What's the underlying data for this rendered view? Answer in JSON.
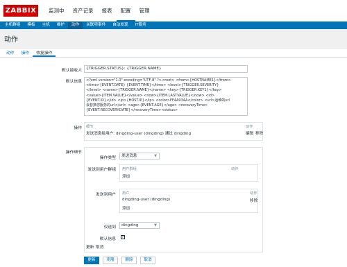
{
  "app": {
    "logo": "ZABBIX"
  },
  "main_menu": [
    {
      "label": "监测中",
      "active": false
    },
    {
      "label": "资产记录",
      "active": false
    },
    {
      "label": "报表",
      "active": false
    },
    {
      "label": "配置",
      "active": true
    },
    {
      "label": "管理",
      "active": false
    }
  ],
  "sub_menu": [
    {
      "label": "主机群组",
      "active": false
    },
    {
      "label": "模板",
      "active": false
    },
    {
      "label": "主机",
      "active": false
    },
    {
      "label": "维护",
      "active": false
    },
    {
      "label": "动作",
      "active": true
    },
    {
      "label": "关联项事件",
      "active": false
    },
    {
      "label": "自动发现",
      "active": false
    },
    {
      "label": "IT服务",
      "active": false
    }
  ],
  "page": {
    "title": "动作"
  },
  "tabs": [
    {
      "label": "动作",
      "active": false
    },
    {
      "label": "操作",
      "active": false
    },
    {
      "label": "恢复操作",
      "active": true
    }
  ],
  "form": {
    "default_subject_label": "默认接收人",
    "default_subject_value": "{TRIGGER.STATUS}: {TRIGGER.NAME}",
    "default_message_label": "默认信息",
    "default_message_lines": [
      "<?xml version=\"1.0\" encoding=\"UTF-8\" ?><root>  <from>{HOSTNAME1}</from>",
      "<time>{EVENT.DATE} {EVENT.TIME}</time>  <level>{TRIGGER.SEVERITY}",
      "</level>  <name>{TRIGGER.NAME}</name>  <key>{TRIGGER.KEY1}</key>",
      "<value>{ITEM.VALUE}</value> <now>{ITEM.LASTVALUE}</now>  <id>",
      "{EVENT.ID}</id>  <ip>{HOST.IP}</ip>  <color>FF4A934A</color> <url>运维的url",
      "会替换您服务的url</url>  <age>{EVENT.AGE}</age>  <recoveryTime>",
      "{EVENT.RECOVERY.DATE}</recoveryTime><status>"
    ],
    "operations_label": "操作",
    "operations_table": {
      "col_details": "细节",
      "col_action": "动作",
      "row_details": "发送消息给用户: dingding-user (dingding) 通过 dingding",
      "edit": "编辑",
      "remove": "移除"
    },
    "op_details_label": "操作细节",
    "op_type_label": "操作类型",
    "op_type_value": "发送消息",
    "send_to_groups_label": "发送到用户群组",
    "groups_col_group": "用户群组",
    "groups_col_action": "动作",
    "groups_add": "添加",
    "send_to_users_label": "发送到用户",
    "users_col_user": "用户",
    "users_col_action": "动作",
    "user_row": "dingding-user (dingding)",
    "user_remove": "移除",
    "users_add": "添加",
    "send_only_to_label": "仅送到",
    "send_only_to_value": "dingding",
    "default_message_chk_label": "默认信息",
    "default_message_checked": true,
    "update_link": "更新",
    "cancel_link": "取消"
  },
  "buttons": {
    "update": "更新",
    "clone": "克隆",
    "delete": "删除",
    "cancel": "取消"
  }
}
